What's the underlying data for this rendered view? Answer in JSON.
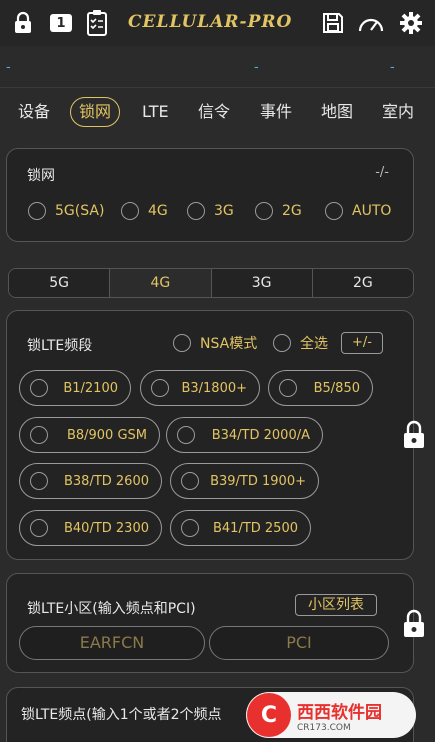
{
  "app": {
    "title": "CELLULAR-PRO",
    "badge": "1"
  },
  "status": {
    "dashes": [
      "-",
      "-",
      "-"
    ]
  },
  "tabs": [
    "设备",
    "锁网",
    "LTE",
    "信令",
    "事件",
    "地图",
    "室内"
  ],
  "active_tab": "锁网",
  "lock_network": {
    "title": "锁网",
    "value": "-/-",
    "options": [
      "5G(SA)",
      "4G",
      "3G",
      "2G",
      "AUTO"
    ]
  },
  "segment": {
    "items": [
      "5G",
      "4G",
      "3G",
      "2G"
    ],
    "active": "4G"
  },
  "lte_bands": {
    "title": "锁LTE频段",
    "nsa_label": "NSA模式",
    "select_all_label": "全选",
    "toggle_label": "+/-",
    "bands": [
      "B1/2100",
      "B3/1800+",
      "B5/850",
      "B8/900 GSM",
      "B34/TD 2000/A",
      "B38/TD 2600",
      "B39/TD 1900+",
      "B40/TD 2300",
      "B41/TD 2500"
    ]
  },
  "lte_cell": {
    "title": "锁LTE小区(输入频点和PCI)",
    "list_button": "小区列表",
    "earfcn_placeholder": "EARFCN",
    "pci_placeholder": "PCI"
  },
  "lte_freq": {
    "title": "锁LTE频点(输入1个或者2个频点"
  },
  "watermark": {
    "logo": "C",
    "main": "西西软件园",
    "sub": "CR173.COM"
  },
  "colors": {
    "accent": "#e2c463",
    "link": "#4fb3d9",
    "bg": "#2b2b2b",
    "card": "#232323"
  }
}
